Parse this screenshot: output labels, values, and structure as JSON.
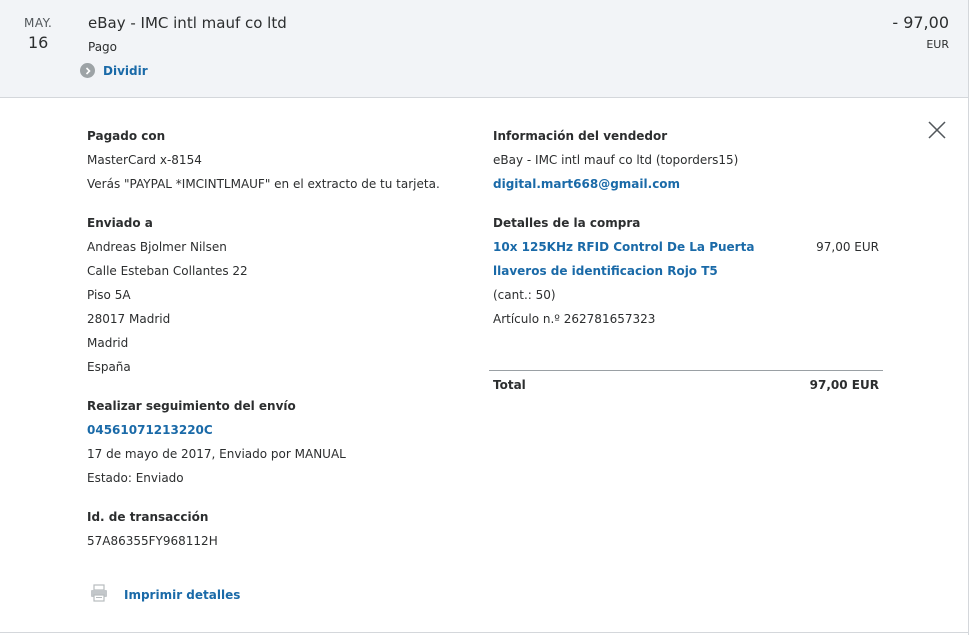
{
  "summary": {
    "month": "MAY.",
    "day": "16",
    "merchant": "eBay - IMC intl mauf co ltd",
    "type": "Pago",
    "split_label": "Dividir",
    "amount": "- 97,00",
    "currency": "EUR"
  },
  "paid_with": {
    "heading": "Pagado con",
    "card": "MasterCard x-8154",
    "statement_note": "Verás \"PAYPAL *IMCINTLMAUF\" en el extracto de tu tarjeta."
  },
  "shipped_to": {
    "heading": "Enviado a",
    "lines": [
      "Andreas Bjolmer Nilsen",
      "Calle Esteban Collantes 22",
      "Piso 5A",
      "28017 Madrid",
      "Madrid",
      "España"
    ]
  },
  "tracking": {
    "heading": "Realizar seguimiento del envío",
    "number": "04561071213220C",
    "shipped_info": "17 de mayo de 2017, Enviado por MANUAL",
    "status": "Estado: Enviado"
  },
  "transaction": {
    "heading": "Id. de transacción",
    "id": "57A86355FY968112H"
  },
  "print_label": "Imprimir detalles",
  "seller": {
    "heading": "Información del vendedor",
    "name": "eBay - IMC intl mauf co ltd (toporders15)",
    "email": "digital.mart668@gmail.com"
  },
  "purchase": {
    "heading": "Detalles de la compra",
    "item_line1": "10x 125KHz RFID Control De La Puerta",
    "item_line2": "llaveros de identificacion Rojo T5",
    "item_price": "97,00 EUR",
    "quantity": "(cant.: 50)",
    "item_number": "Artículo n.º 262781657323"
  },
  "total": {
    "label": "Total",
    "value": "97,00 EUR"
  },
  "colors": {
    "link": "#1a6aa8",
    "summary_bg": "#f2f4f7",
    "text": "#2c2e2f"
  }
}
